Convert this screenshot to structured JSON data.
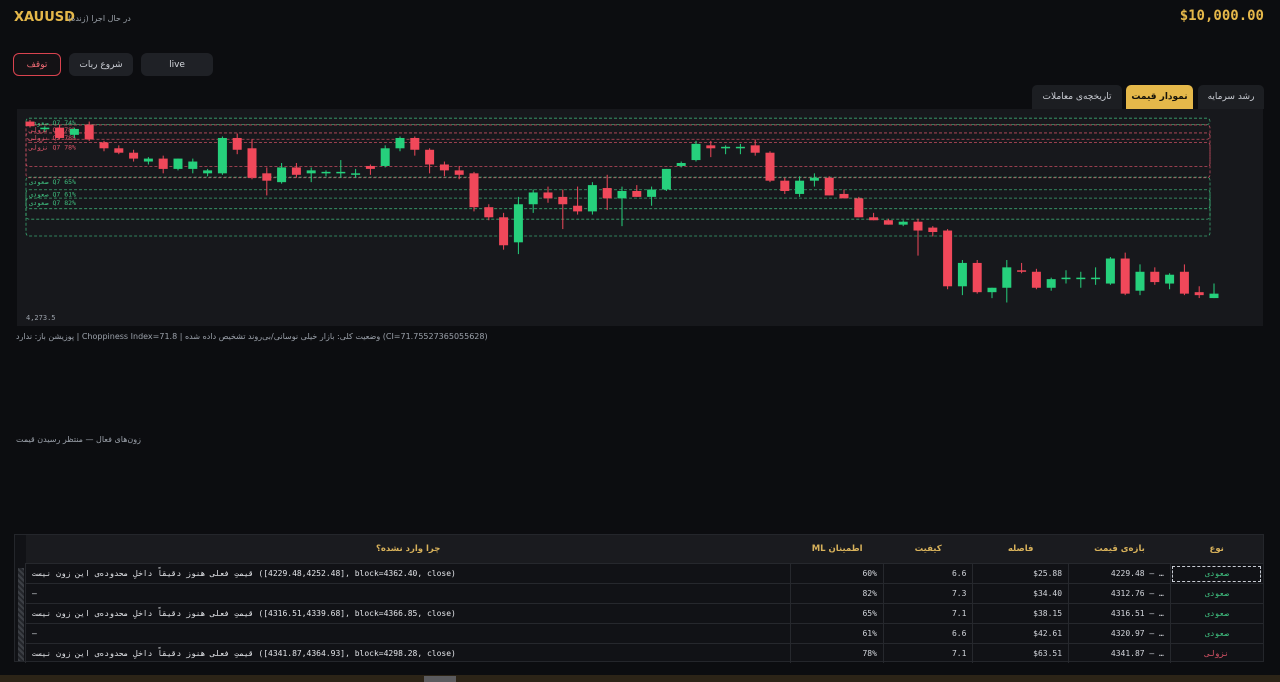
{
  "header": {
    "symbol": "XAUUSD",
    "status": "در حال اجرا (زنده)",
    "balance": "$10,000.00"
  },
  "controls": {
    "stop": "توقف",
    "start": "شروع ربات",
    "mode": "live"
  },
  "tabs": [
    {
      "label": "رشد سرمایه",
      "active": false
    },
    {
      "label": "نمودار قیمت",
      "active": true
    },
    {
      "label": "تاریخچه‌ی معاملات",
      "active": false
    }
  ],
  "chart_data": {
    "type": "candlestick",
    "ylabel_bottom": "4,273.5",
    "candles": [
      {
        "o": 4366.4,
        "h": 4367.2,
        "l": 4363.6,
        "c": 4364.2
      },
      {
        "o": 4362.8,
        "h": 4364.2,
        "l": 4361.6,
        "c": 4363.5
      },
      {
        "o": 4363.5,
        "h": 4364.8,
        "l": 4357.9,
        "c": 4358.6
      },
      {
        "o": 4360.1,
        "h": 4363.5,
        "l": 4358.6,
        "c": 4362.9
      },
      {
        "o": 4365.0,
        "h": 4366.4,
        "l": 4357.2,
        "c": 4357.9
      },
      {
        "o": 4356.5,
        "h": 4357.2,
        "l": 4352.3,
        "c": 4353.7
      },
      {
        "o": 4353.7,
        "h": 4355.1,
        "l": 4350.9,
        "c": 4351.6
      },
      {
        "o": 4351.6,
        "h": 4353.0,
        "l": 4347.4,
        "c": 4348.8
      },
      {
        "o": 4347.4,
        "h": 4349.5,
        "l": 4346.0,
        "c": 4348.8
      },
      {
        "o": 4348.8,
        "h": 4350.2,
        "l": 4341.8,
        "c": 4343.9
      },
      {
        "o": 4343.9,
        "h": 4348.8,
        "l": 4343.2,
        "c": 4348.8
      },
      {
        "o": 4343.9,
        "h": 4348.8,
        "l": 4341.8,
        "c": 4347.4
      },
      {
        "o": 4341.8,
        "h": 4343.9,
        "l": 4340.4,
        "c": 4343.2
      },
      {
        "o": 4341.8,
        "h": 4359.3,
        "l": 4341.1,
        "c": 4358.6
      },
      {
        "o": 4358.6,
        "h": 4360.7,
        "l": 4350.9,
        "c": 4353.0
      },
      {
        "o": 4353.7,
        "h": 4357.9,
        "l": 4339.0,
        "c": 4339.7
      },
      {
        "o": 4341.8,
        "h": 4344.6,
        "l": 4331.3,
        "c": 4338.3
      },
      {
        "o": 4337.6,
        "h": 4346.7,
        "l": 4336.9,
        "c": 4344.6
      },
      {
        "o": 4344.6,
        "h": 4346.7,
        "l": 4339.7,
        "c": 4341.1
      },
      {
        "o": 4341.8,
        "h": 4344.6,
        "l": 4337.6,
        "c": 4343.2
      },
      {
        "o": 4342.5,
        "h": 4343.2,
        "l": 4340.4,
        "c": 4342.5
      },
      {
        "o": 4342.5,
        "h": 4348.1,
        "l": 4339.7,
        "c": 4342.5
      },
      {
        "o": 4341.8,
        "h": 4343.9,
        "l": 4339.7,
        "c": 4341.8
      },
      {
        "o": 4345.3,
        "h": 4346.0,
        "l": 4341.1,
        "c": 4343.9
      },
      {
        "o": 4345.3,
        "h": 4355.1,
        "l": 4344.6,
        "c": 4353.7
      },
      {
        "o": 4353.7,
        "h": 4359.3,
        "l": 4352.3,
        "c": 4358.6
      },
      {
        "o": 4358.6,
        "h": 4359.3,
        "l": 4350.2,
        "c": 4353.0
      },
      {
        "o": 4353.0,
        "h": 4353.7,
        "l": 4341.8,
        "c": 4346.0
      },
      {
        "o": 4346.0,
        "h": 4347.4,
        "l": 4340.4,
        "c": 4343.2
      },
      {
        "o": 4343.2,
        "h": 4345.3,
        "l": 4339.0,
        "c": 4341.1
      },
      {
        "o": 4341.8,
        "h": 4342.5,
        "l": 4323.7,
        "c": 4325.7
      },
      {
        "o": 4325.7,
        "h": 4327.1,
        "l": 4319.5,
        "c": 4320.9
      },
      {
        "o": 4320.9,
        "h": 4323.0,
        "l": 4305.5,
        "c": 4307.6
      },
      {
        "o": 4309.0,
        "h": 4330.6,
        "l": 4303.4,
        "c": 4327.1
      },
      {
        "o": 4327.1,
        "h": 4334.1,
        "l": 4323.0,
        "c": 4332.7
      },
      {
        "o": 4332.7,
        "h": 4335.5,
        "l": 4327.8,
        "c": 4329.9
      },
      {
        "o": 4330.6,
        "h": 4334.1,
        "l": 4315.3,
        "c": 4327.1
      },
      {
        "o": 4326.4,
        "h": 4335.5,
        "l": 4322.2,
        "c": 4323.7
      },
      {
        "o": 4323.7,
        "h": 4337.6,
        "l": 4322.2,
        "c": 4336.2
      },
      {
        "o": 4334.8,
        "h": 4341.1,
        "l": 4324.4,
        "c": 4329.9
      },
      {
        "o": 4329.9,
        "h": 4335.5,
        "l": 4316.7,
        "c": 4333.4
      },
      {
        "o": 4333.4,
        "h": 4336.2,
        "l": 4330.6,
        "c": 4330.6
      },
      {
        "o": 4330.6,
        "h": 4335.5,
        "l": 4326.4,
        "c": 4334.1
      },
      {
        "o": 4334.1,
        "h": 4343.9,
        "l": 4333.4,
        "c": 4343.9
      },
      {
        "o": 4345.3,
        "h": 4347.4,
        "l": 4344.6,
        "c": 4346.7
      },
      {
        "o": 4348.1,
        "h": 4357.2,
        "l": 4347.4,
        "c": 4355.8
      },
      {
        "o": 4355.1,
        "h": 4357.2,
        "l": 4349.5,
        "c": 4353.7
      },
      {
        "o": 4353.7,
        "h": 4355.1,
        "l": 4350.9,
        "c": 4354.4
      },
      {
        "o": 4354.4,
        "h": 4355.8,
        "l": 4350.9,
        "c": 4354.4
      },
      {
        "o": 4355.1,
        "h": 4357.9,
        "l": 4350.2,
        "c": 4351.6
      },
      {
        "o": 4351.6,
        "h": 4352.3,
        "l": 4337.6,
        "c": 4338.3
      },
      {
        "o": 4338.3,
        "h": 4339.7,
        "l": 4332.0,
        "c": 4333.4
      },
      {
        "o": 4332.0,
        "h": 4340.4,
        "l": 4330.6,
        "c": 4338.3
      },
      {
        "o": 4338.3,
        "h": 4341.8,
        "l": 4335.5,
        "c": 4339.7
      },
      {
        "o": 4339.7,
        "h": 4340.4,
        "l": 4331.3,
        "c": 4331.3
      },
      {
        "o": 4332.0,
        "h": 4334.1,
        "l": 4329.9,
        "c": 4329.9
      },
      {
        "o": 4329.9,
        "h": 4330.6,
        "l": 4320.9,
        "c": 4320.9
      },
      {
        "o": 4320.9,
        "h": 4323.0,
        "l": 4319.5,
        "c": 4319.5
      },
      {
        "o": 4319.5,
        "h": 4320.2,
        "l": 4317.4,
        "c": 4317.4
      },
      {
        "o": 4317.4,
        "h": 4319.5,
        "l": 4316.7,
        "c": 4318.8
      },
      {
        "o": 4318.8,
        "h": 4320.2,
        "l": 4302.7,
        "c": 4314.6
      },
      {
        "o": 4316.0,
        "h": 4316.7,
        "l": 4311.8,
        "c": 4313.9
      },
      {
        "o": 4314.6,
        "h": 4315.3,
        "l": 4286.7,
        "c": 4288.1
      },
      {
        "o": 4288.1,
        "h": 4300.6,
        "l": 4283.9,
        "c": 4299.2
      },
      {
        "o": 4299.2,
        "h": 4300.6,
        "l": 4284.6,
        "c": 4285.3
      },
      {
        "o": 4285.3,
        "h": 4287.4,
        "l": 4282.5,
        "c": 4287.4
      },
      {
        "o": 4287.4,
        "h": 4300.6,
        "l": 4280.4,
        "c": 4297.1
      },
      {
        "o": 4295.7,
        "h": 4299.2,
        "l": 4294.3,
        "c": 4295.0
      },
      {
        "o": 4295.0,
        "h": 4296.4,
        "l": 4286.7,
        "c": 4287.4
      },
      {
        "o": 4287.4,
        "h": 4292.2,
        "l": 4286.0,
        "c": 4291.5
      },
      {
        "o": 4292.2,
        "h": 4295.7,
        "l": 4289.4,
        "c": 4292.2
      },
      {
        "o": 4292.2,
        "h": 4295.0,
        "l": 4287.4,
        "c": 4292.2
      },
      {
        "o": 4291.5,
        "h": 4297.1,
        "l": 4288.8,
        "c": 4292.2
      },
      {
        "o": 4289.4,
        "h": 4302.0,
        "l": 4288.8,
        "c": 4301.3
      },
      {
        "o": 4301.3,
        "h": 4304.1,
        "l": 4283.9,
        "c": 4284.6
      },
      {
        "o": 4286.0,
        "h": 4298.5,
        "l": 4283.9,
        "c": 4295.0
      },
      {
        "o": 4295.0,
        "h": 4297.1,
        "l": 4288.8,
        "c": 4290.1
      },
      {
        "o": 4289.4,
        "h": 4294.3,
        "l": 4286.7,
        "c": 4293.6
      },
      {
        "o": 4295.0,
        "h": 4298.5,
        "l": 4283.9,
        "c": 4284.6
      },
      {
        "o": 4285.3,
        "h": 4288.1,
        "l": 4282.5,
        "c": 4283.9
      },
      {
        "o": 4282.5,
        "h": 4289.4,
        "l": 4282.5,
        "c": 4284.6
      }
    ],
    "zones": [
      {
        "top": 4368.0,
        "bottom": 4365.0,
        "dir": "buy",
        "label": "صعودی Q7 74%"
      },
      {
        "top": 4364.8,
        "bottom": 4339.7,
        "dir": "sell",
        "label": "نزولی Q7 78%"
      },
      {
        "top": 4361.0,
        "bottom": 4358.0,
        "dir": "sell",
        "label": "نزولی Q7 78%"
      },
      {
        "top": 4356.5,
        "bottom": 4345.0,
        "dir": "sell",
        "label": "نزولی Q7 78%"
      },
      {
        "top": 4340.0,
        "bottom": 4312.0,
        "dir": "buy",
        "label": "صعودی Q7 65%"
      },
      {
        "top": 4334.0,
        "bottom": 4325.0,
        "dir": "buy",
        "label": "صعودی Q7 61%"
      },
      {
        "top": 4330.0,
        "bottom": 4320.0,
        "dir": "buy",
        "label": "صعودی Q7 82%"
      }
    ]
  },
  "info_line": "پوزیشن باز: ندارد  |  Choppiness Index=71.8  |  وضعیت کلی: بازار خیلی نوسانی/بی‌روند تشخیص داده شده (CI=71.75527365055628)",
  "zones_message": "زون‌های فعال — منتظر رسیدن قیمت",
  "table": {
    "headers": {
      "type": "نوع",
      "range": "بازه‌ی قیمت",
      "distance": "فاصله",
      "quality": "کیفیت",
      "ml": "ML اطمینان",
      "reason": "چرا وارد نشده؟"
    },
    "rows": [
      {
        "type": "صعودی",
        "dir": "buy",
        "range": "4229.48 – …",
        "distance": "$25.88",
        "quality": "6.6",
        "ml": "60%",
        "reason": "قیمتِ فعلی هنوز دقیقاً داخلِ محدوده‌ی این زون نیست ([4229.48,4252.48], block=4362.40, close)"
      },
      {
        "type": "صعودی",
        "dir": "buy",
        "range": "4312.76 – …",
        "distance": "$34.40",
        "quality": "7.3",
        "ml": "82%",
        "reason": "—"
      },
      {
        "type": "صعودی",
        "dir": "buy",
        "range": "4316.51 – …",
        "distance": "$38.15",
        "quality": "7.1",
        "ml": "65%",
        "reason": "قیمتِ فعلی هنوز دقیقاً داخلِ محدوده‌ی این زون نیست ([4316.51,4339.68], block=4366.85, close)"
      },
      {
        "type": "صعودی",
        "dir": "buy",
        "range": "4320.97 – …",
        "distance": "$42.61",
        "quality": "6.6",
        "ml": "61%",
        "reason": "—"
      },
      {
        "type": "نزولی",
        "dir": "sell",
        "range": "4341.87 – …",
        "distance": "$63.51",
        "quality": "7.1",
        "ml": "78%",
        "reason": "قیمتِ فعلی هنوز دقیقاً داخلِ محدوده‌ی این زون نیست ([4341.87,4364.93], block=4298.28, close)"
      }
    ]
  },
  "colors": {
    "accent": "#e5b84a",
    "up": "#26d07c",
    "down": "#f0485a",
    "panel": "#17181c"
  }
}
